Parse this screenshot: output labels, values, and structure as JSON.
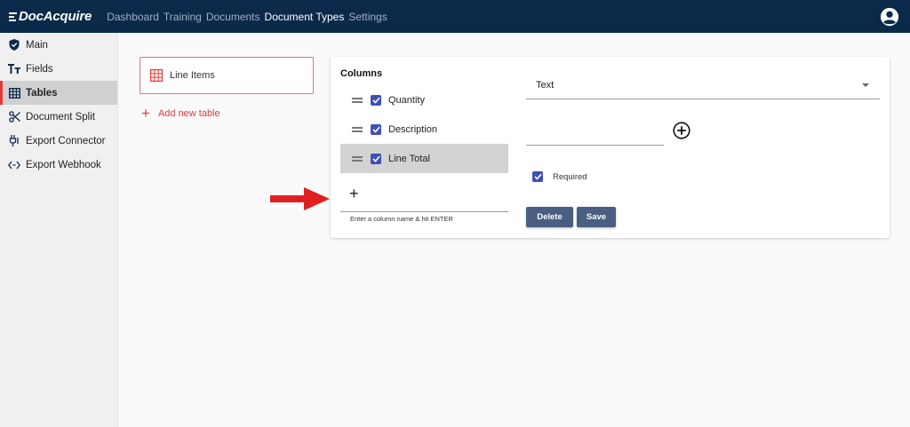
{
  "app": {
    "logo_text": "DocAcquire"
  },
  "nav": {
    "items": [
      {
        "label": "Dashboard",
        "active": false
      },
      {
        "label": "Training",
        "active": false
      },
      {
        "label": "Documents",
        "active": false
      },
      {
        "label": "Document Types",
        "active": true
      },
      {
        "label": "Settings",
        "active": false
      }
    ],
    "account_icon": "account-circle-icon"
  },
  "sidebar": {
    "items": [
      {
        "label": "Main",
        "icon": "shield-check-icon",
        "active": false
      },
      {
        "label": "Fields",
        "icon": "text-format-icon",
        "active": false
      },
      {
        "label": "Tables",
        "icon": "table-icon",
        "active": true
      },
      {
        "label": "Document Split",
        "icon": "scissors-icon",
        "active": false
      },
      {
        "label": "Export Connector",
        "icon": "connector-icon",
        "active": false
      },
      {
        "label": "Export Webhook",
        "icon": "code-brackets-icon",
        "active": false
      }
    ]
  },
  "tables": {
    "items": [
      {
        "label": "Line Items",
        "icon": "grid-table-icon"
      }
    ],
    "add_label": "Add new table"
  },
  "editor": {
    "columns_title": "Columns",
    "columns": [
      {
        "label": "Quantity",
        "checked": true,
        "selected": false
      },
      {
        "label": "Description",
        "checked": true,
        "selected": false
      },
      {
        "label": "Line Total",
        "checked": true,
        "selected": true
      }
    ],
    "new_column": {
      "value": "",
      "hint": "Enter a column name & hit ENTER"
    },
    "type_select": {
      "value": "Text"
    },
    "option_input": {
      "value": ""
    },
    "required": {
      "label": "Required",
      "checked": true
    },
    "delete_label": "Delete",
    "save_label": "Save"
  },
  "colors": {
    "topbar": "#0b2a4a",
    "accent_red": "#e53935",
    "checkbox": "#3f51b5",
    "button": "#4a5e82"
  }
}
